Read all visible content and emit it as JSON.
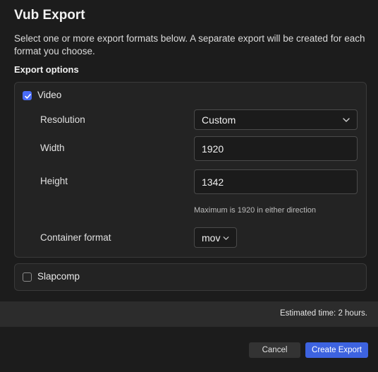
{
  "dialog": {
    "title": "Vub Export",
    "description": "Select one or more export formats below. A separate export will be created for each format you choose.",
    "section_label": "Export options"
  },
  "video": {
    "checked": true,
    "label": "Video",
    "resolution_label": "Resolution",
    "resolution_value": "Custom",
    "width_label": "Width",
    "width_value": "1920",
    "height_label": "Height",
    "height_value": "1342",
    "hint": "Maximum is 1920 in either direction",
    "container_label": "Container format",
    "container_value": "mov"
  },
  "slapcomp": {
    "checked": false,
    "label": "Slapcomp"
  },
  "footer": {
    "estimated_time": "Estimated time: 2 hours."
  },
  "buttons": {
    "cancel": "Cancel",
    "create": "Create Export"
  },
  "colors": {
    "accent": "#3d63e0",
    "background": "#1c1c1c",
    "panel": "#232323"
  },
  "icons": {
    "check": "checkmark-icon",
    "dropdown": "chevron-down-icon"
  }
}
